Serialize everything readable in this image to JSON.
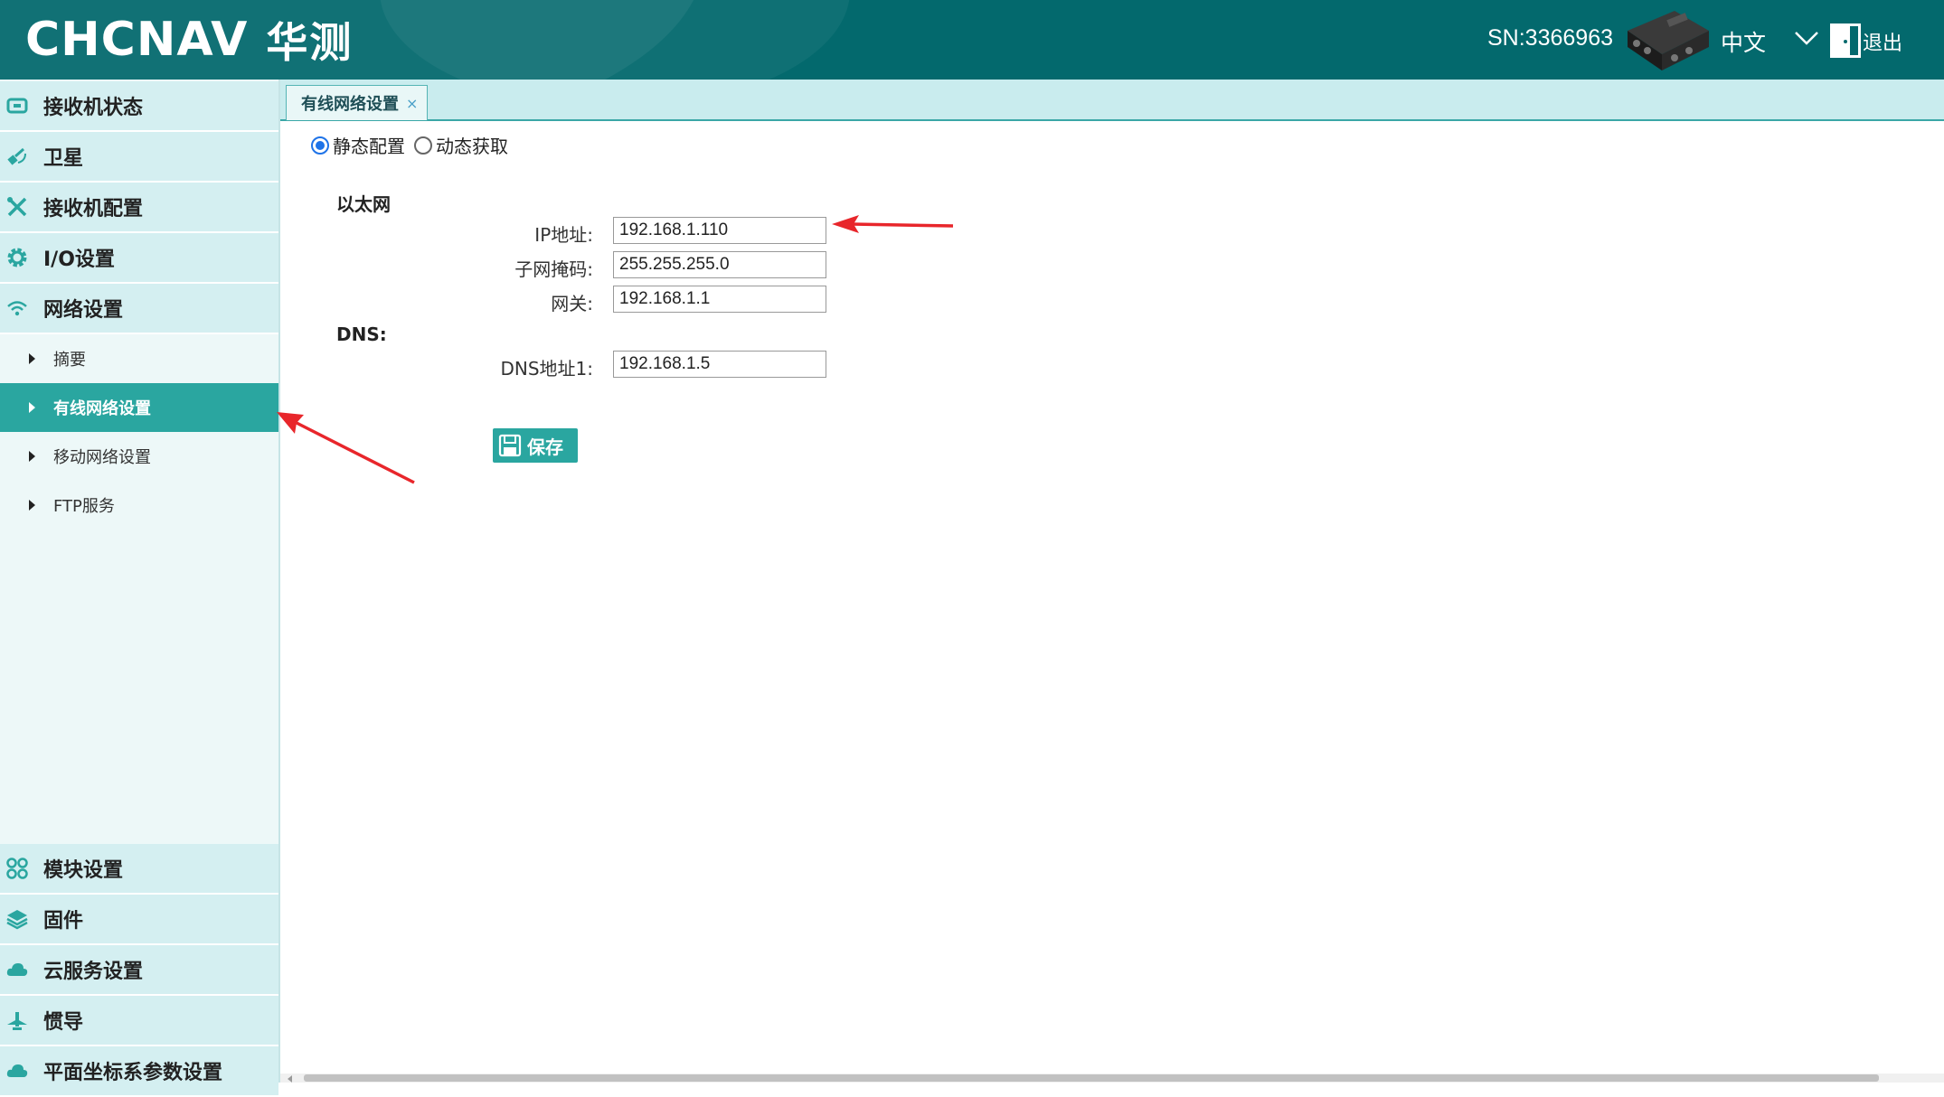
{
  "header": {
    "brand": "CHCNAV",
    "brand_cn": "华测",
    "sn": "SN:3366963",
    "language": "中文",
    "logout": "退出"
  },
  "sidebar": {
    "top_items": [
      {
        "label": "接收机状态",
        "icon": "receiver-status-icon"
      },
      {
        "label": "卫星",
        "icon": "satellite-icon"
      },
      {
        "label": "接收机配置",
        "icon": "tools-icon"
      },
      {
        "label": "I/O设置",
        "icon": "gear-icon"
      },
      {
        "label": "网络设置",
        "icon": "wifi-icon"
      }
    ],
    "sub_items": [
      {
        "label": "摘要",
        "active": false
      },
      {
        "label": "有线网络设置",
        "active": true
      },
      {
        "label": "移动网络设置",
        "active": false
      },
      {
        "label": "FTP服务",
        "active": false
      }
    ],
    "bottom_items": [
      {
        "label": "模块设置",
        "icon": "modules-icon"
      },
      {
        "label": "固件",
        "icon": "layers-icon"
      },
      {
        "label": "云服务设置",
        "icon": "cloud-icon"
      },
      {
        "label": "惯导",
        "icon": "plane-icon"
      },
      {
        "label": "平面坐标系参数设置",
        "icon": "cloud-icon"
      }
    ]
  },
  "tab": {
    "label": "有线网络设置",
    "close": "×"
  },
  "form": {
    "mode_options": [
      "静态配置",
      "动态获取"
    ],
    "selected_mode": "静态配置",
    "ethernet_title": "以太网",
    "ip_label": "IP地址:",
    "ip_value": "192.168.1.110",
    "mask_label": "子网掩码:",
    "mask_value": "255.255.255.0",
    "gateway_label": "网关:",
    "gateway_value": "192.168.1.1",
    "dns_title": "DNS:",
    "dns1_label": "DNS地址1:",
    "dns1_value": "192.168.1.5",
    "save_label": "保存"
  },
  "colors": {
    "header_bg": "#03696d",
    "accent": "#2aa6a0",
    "sidebar_bg": "#d4eff1",
    "annotation_arrow": "#e8262b"
  }
}
